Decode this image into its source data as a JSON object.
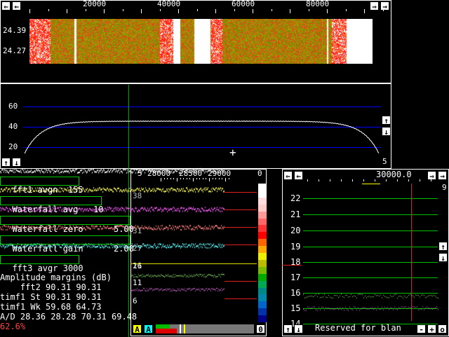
{
  "waterfall": {
    "freq_labels": [
      "20000",
      "40000",
      "60000",
      "80000"
    ],
    "time_labels": [
      "24.39",
      "24.27"
    ]
  },
  "spectrum": {
    "y_labels": [
      "60",
      "40",
      "20"
    ],
    "corner_value": "5"
  },
  "lower_left": {
    "header_label": "5",
    "freq_labels": [
      "28000",
      "28500",
      "29000"
    ],
    "corner_value": "0",
    "side_labels": [
      "38",
      "31",
      "27",
      "21",
      "16",
      "11",
      "6"
    ],
    "params": [
      {
        "name": "fft1 avgn",
        "value": "155"
      },
      {
        "name": "Waterfall avg",
        "value": "10"
      },
      {
        "name": "Waterfall zero",
        "value": "5.00"
      },
      {
        "name": "Waterfall gain",
        "value": "2.00"
      },
      {
        "name": "fft3 avgr",
        "value": "3000"
      }
    ],
    "margins_title": "Amplitude margins (dB)",
    "margin_rows": [
      {
        "label": "fft2",
        "v1": "90.31",
        "v2": "90.31"
      },
      {
        "label": "timf1 St",
        "v1": "90.31",
        "v2": "90.31"
      },
      {
        "label": "timf1 Wk",
        "v1": "59.68",
        "v2": "64.73"
      }
    ],
    "ad_row": {
      "label": "A/D",
      "v1": "28.36",
      "v2": "28.28",
      "v3": "70.31",
      "v4": "69.48"
    },
    "cpu_load": "62.6%",
    "buttons": [
      "A",
      "A"
    ],
    "bar_value": "0"
  },
  "baseband": {
    "freq_label": "30000.0",
    "top_right_value": "9",
    "y_labels": [
      "22",
      "21",
      "20",
      "19",
      "18",
      "17",
      "16",
      "15",
      "14"
    ],
    "footer_text": "Reserved for blan",
    "footer_buttons": [
      "-",
      "+",
      "o"
    ]
  },
  "colors": {
    "accent_blue": "#0000ff",
    "grid_green": "#00c000",
    "red_marker": "#e02020",
    "cpu_red": "#ff4040"
  }
}
